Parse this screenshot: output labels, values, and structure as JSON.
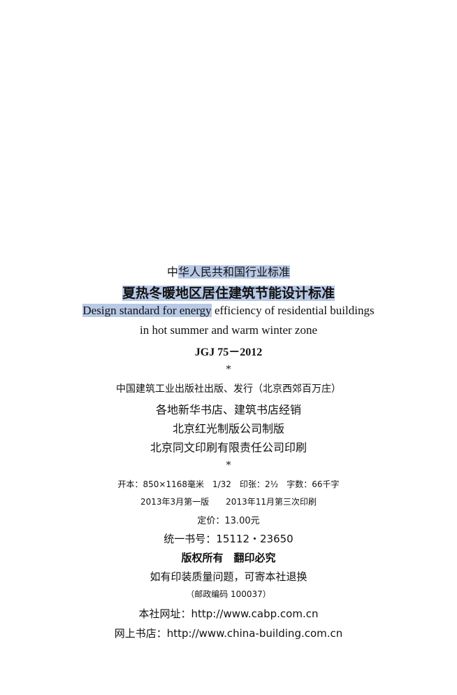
{
  "page": {
    "standard_category_prefix": "中",
    "standard_category_selected": "华人民共和国行业标准",
    "title_cn": "夏热冬暖地区居住建筑节能设计标准",
    "title_en_selected": "Design standard for energy",
    "title_en_rest": " efficiency of residential buildings",
    "title_en_line2": "in hot summer and warm winter zone",
    "code": "JGJ 75－2012",
    "separator_1": "*",
    "publisher": "中国建筑工业出版社出版、发行（北京西郊百万庄）",
    "distributor": "各地新华书店、建筑书店经销",
    "plate_maker": "北京红光制版公司制版",
    "printer": "北京同文印刷有限责任公司印刷",
    "separator_2": "*",
    "format_info": "开本：850×1168毫米　1/32　印张：2½　字数：66千字",
    "edition_info": "2013年3月第一版　　2013年11月第三次印刷",
    "price": "定价：13.00元",
    "book_number": "统一书号：15112・23650",
    "copyright": "版权所有　翻印必究",
    "quality_notice": "如有印装质量问题，可寄本社退换",
    "postcode": "（邮政编码 100037）",
    "website": "本社网址：http://www.cabp.com.cn",
    "online_store": "网上书店：http://www.china-building.com.cn"
  },
  "colors": {
    "selection_highlight": "#b8c9e6",
    "text": "#111111",
    "background": "#ffffff"
  }
}
